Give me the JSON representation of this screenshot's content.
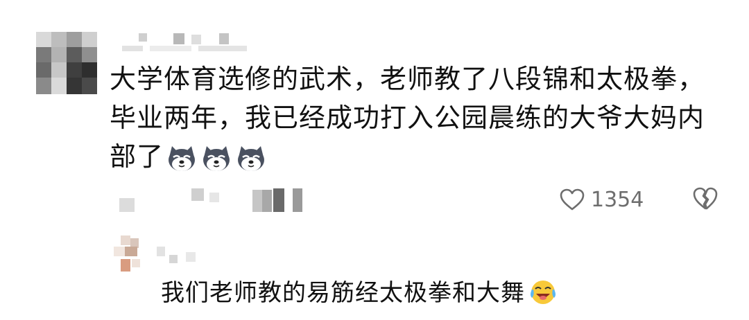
{
  "comment": {
    "text": "大学体育选修的武术，老师教了八段锦和太极拳，毕业两年，我已经成功打入公园晨练的大爷大妈内部了",
    "emojis": [
      "shiba-dog-emoji",
      "shiba-dog-emoji",
      "shiba-dog-emoji"
    ]
  },
  "actions": {
    "like_count": "1354",
    "like_icon": "heart-outline-icon",
    "dislike_icon": "broken-heart-icon"
  },
  "reply": {
    "text": "我们老师教的易筋经太极拳和大舞",
    "emoji": "crying-laughing-face-emoji"
  },
  "colors": {
    "text": "#111111",
    "meta": "#6d6d6d",
    "background": "#ffffff"
  }
}
